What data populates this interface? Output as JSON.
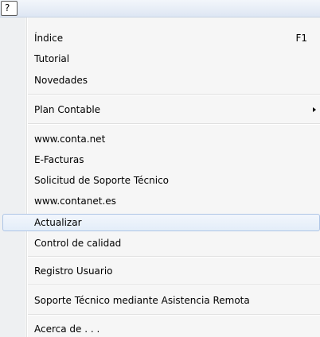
{
  "menubar": {
    "help_menu_label": "?"
  },
  "menu": {
    "items": [
      {
        "label": "Índice",
        "shortcut": "F1"
      },
      {
        "label": "Tutorial"
      },
      {
        "label": "Novedades"
      },
      {
        "label": "Plan Contable",
        "submenu": true
      },
      {
        "label": "www.conta.net"
      },
      {
        "label": "E-Facturas"
      },
      {
        "label": "Solicitud de Soporte Técnico"
      },
      {
        "label": "www.contanet.es"
      },
      {
        "label": "Actualizar",
        "highlighted": true
      },
      {
        "label": "Control de calidad"
      },
      {
        "label": "Registro Usuario"
      },
      {
        "label": "Soporte Técnico mediante Asistencia Remota"
      },
      {
        "label": "Acerca de . . ."
      }
    ]
  },
  "colors": {
    "highlight_border": "#aec5e6",
    "highlight_fill": "#e3edf9",
    "menu_background": "#f6f6f6"
  }
}
